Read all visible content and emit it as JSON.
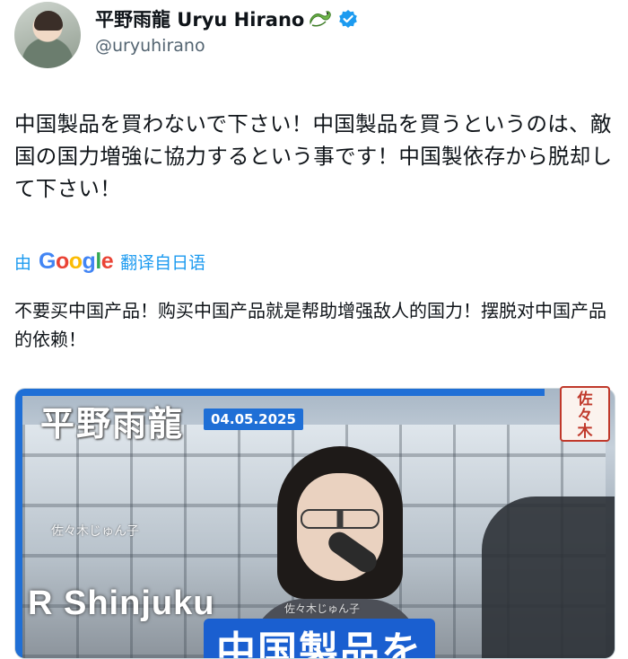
{
  "profile": {
    "display_name": "平野雨龍 Uryu Hirano",
    "handle": "@uryuhirano",
    "verified": true,
    "name_emoji": "dragon-icon"
  },
  "tweet": {
    "text": "中国製品を買わないで下さい！中国製品を買うというのは、敵国の国力増強に協力するという事です！中国製依存から脱却して下さい！"
  },
  "translation": {
    "prefix": "由",
    "provider": "Google",
    "suffix": "翻译自日语",
    "text": "不要买中国产品！购买中国产品就是帮助增强敌人的国力！摆脱对中国产品的依赖！"
  },
  "media": {
    "overlay_name": "平野雨龍",
    "date": "04.05.2025",
    "watermark": "佐々木じゅん子",
    "watermark_small": "佐々木じゅん子",
    "sign_text": "R Shinjuku",
    "caption": "中国製品を",
    "seal": "佐々木"
  },
  "colors": {
    "link": "#1d9bf0",
    "verified": "#1d9bf0",
    "badge": "#1f6fd6",
    "seal": "#c0392b"
  }
}
